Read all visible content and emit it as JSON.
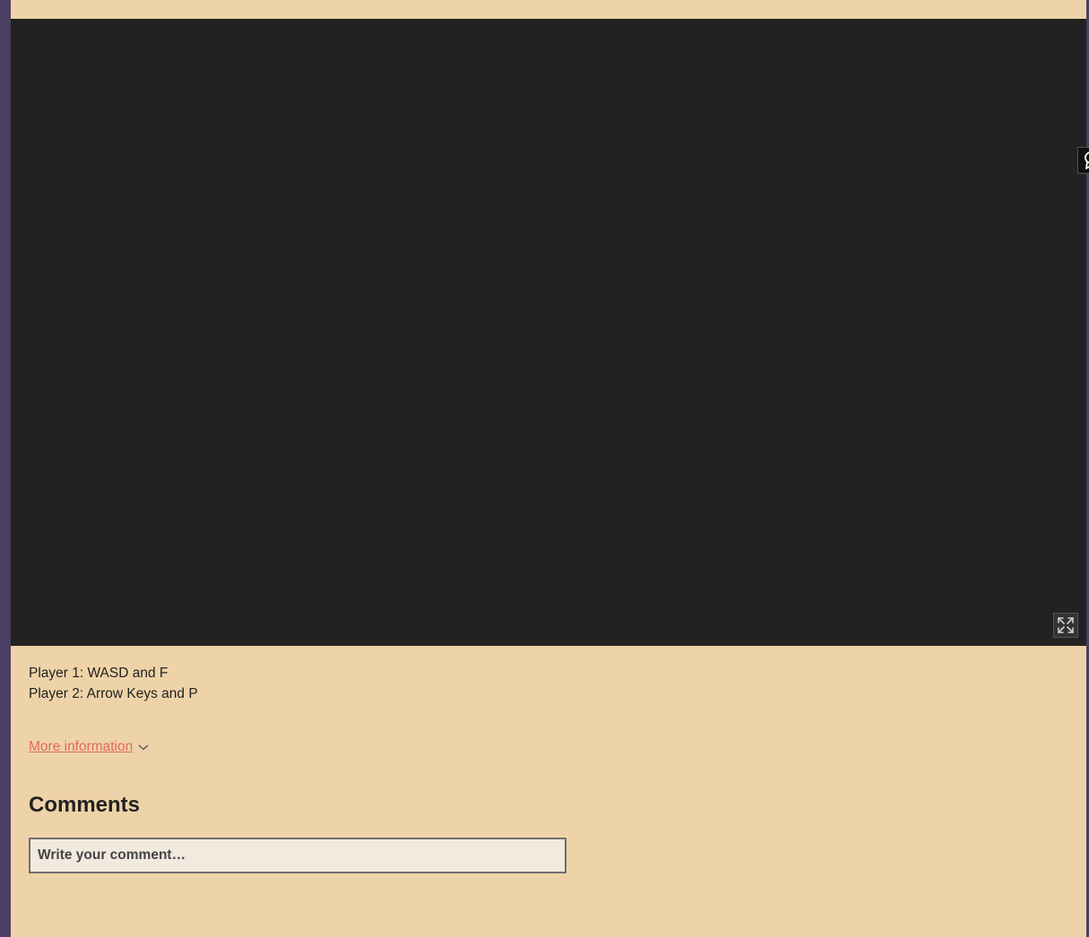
{
  "game": {
    "controls": [
      "Player 1: WASD and F",
      "Player 2: Arrow Keys and P"
    ]
  },
  "icons": {
    "fullscreen": "fullscreen-icon",
    "badge": "award-icon",
    "chevron": "chevron-down-icon"
  },
  "more_info": {
    "label": "More information"
  },
  "comments": {
    "title": "Comments",
    "placeholder": "Write your comment…"
  },
  "colors": {
    "page_bg": "#efd3a8",
    "side_bg": "#4a3f62",
    "game_bg": "#222222",
    "link": "#e06b5b"
  }
}
